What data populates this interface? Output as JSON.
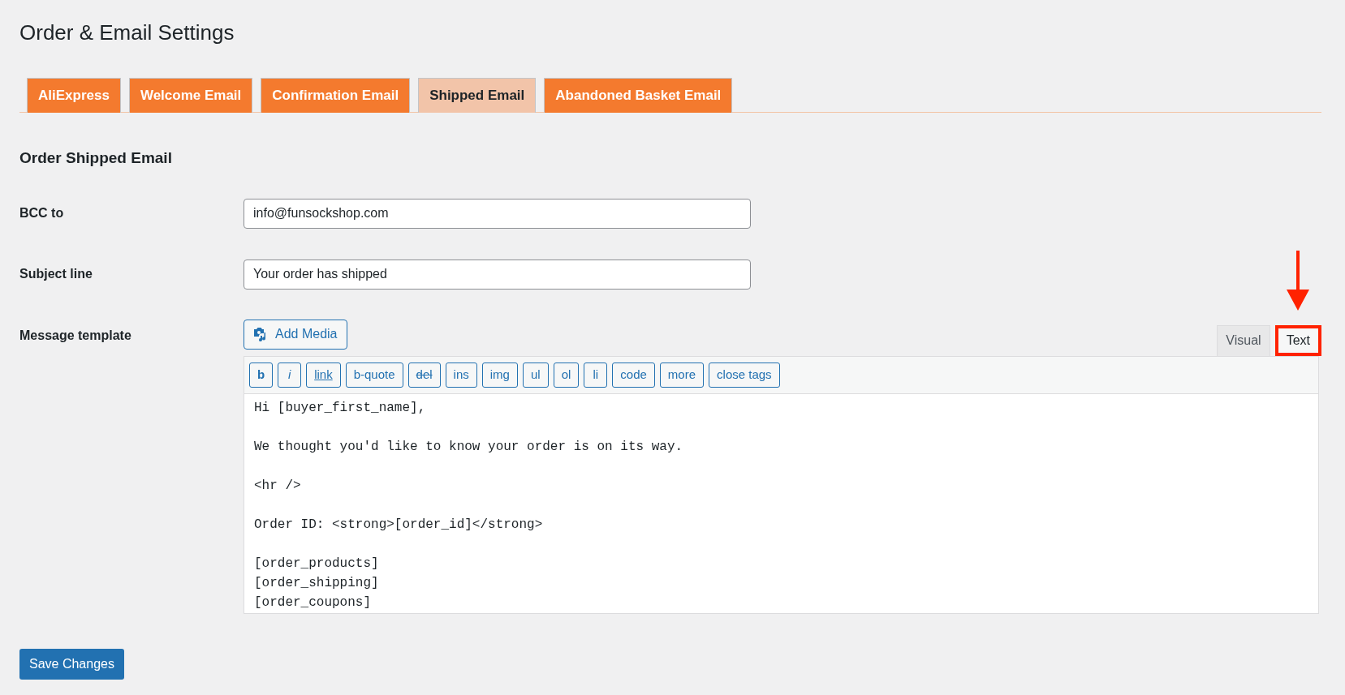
{
  "title": "Order & Email Settings",
  "tabs": [
    {
      "label": "AliExpress",
      "selected": false
    },
    {
      "label": "Welcome Email",
      "selected": false
    },
    {
      "label": "Confirmation Email",
      "selected": false
    },
    {
      "label": "Shipped Email",
      "selected": true
    },
    {
      "label": "Abandoned Basket Email",
      "selected": false
    }
  ],
  "section_title": "Order Shipped Email",
  "fields": [
    {
      "label": "BCC to",
      "value": "info@funsockshop.com"
    },
    {
      "label": "Subject line",
      "value": "Your order has shipped"
    }
  ],
  "message_template": {
    "label": "Message template",
    "add_media": "Add Media",
    "editor_tabs": [
      {
        "label": "Visual",
        "selected": false,
        "highlighted": false
      },
      {
        "label": "Text",
        "selected": true,
        "highlighted": true
      }
    ],
    "quicktags": [
      {
        "label": "b",
        "kind": "bold"
      },
      {
        "label": "i",
        "kind": "italic"
      },
      {
        "label": "link",
        "kind": "underline"
      },
      {
        "label": "b-quote",
        "kind": "plain"
      },
      {
        "label": "del",
        "kind": "strike"
      },
      {
        "label": "ins",
        "kind": "plain"
      },
      {
        "label": "img",
        "kind": "plain"
      },
      {
        "label": "ul",
        "kind": "plain"
      },
      {
        "label": "ol",
        "kind": "plain"
      },
      {
        "label": "li",
        "kind": "plain"
      },
      {
        "label": "code",
        "kind": "plain"
      },
      {
        "label": "more",
        "kind": "plain"
      },
      {
        "label": "close tags",
        "kind": "plain"
      }
    ],
    "paragraphs": [
      [
        "Hi [buyer_first_name],"
      ],
      [
        "We thought you'd like to know your order is on its way."
      ],
      [
        "<hr />"
      ],
      [
        "Order ID: <strong>[order_id]</strong>"
      ],
      [
        "[order_products]",
        "[order_shipping]",
        "[order_coupons]"
      ]
    ]
  },
  "save_button": "Save Changes"
}
